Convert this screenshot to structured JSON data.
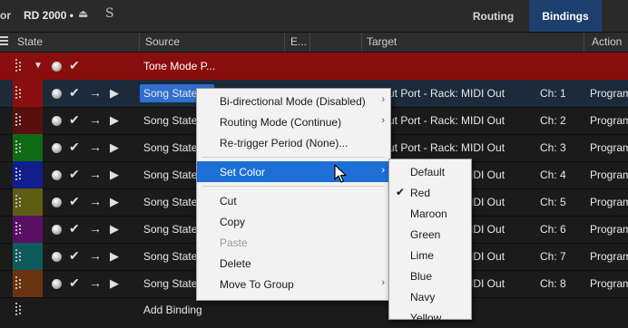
{
  "topbar": {
    "edge_text": "or",
    "device_name": "RD 2000 •",
    "eject_glyph": "⏏",
    "logo_glyph": "S",
    "tabs": [
      {
        "label": "Routing",
        "active": false
      },
      {
        "label": "Bindings",
        "active": true
      }
    ]
  },
  "columns": {
    "state": "State",
    "source": "Source",
    "e": "E...",
    "target": "Target",
    "action": "Action"
  },
  "group_row": {
    "title": "Tone Mode P...",
    "color": "#8a0e0e"
  },
  "rows": [
    {
      "source": "Song State",
      "target": "ut Port - Rack: MIDI Out",
      "channel": "Ch: 1",
      "action": "Program",
      "color": "#8b0f0f",
      "selected": true
    },
    {
      "source": "Song State",
      "target": "ut Port - Rack: MIDI Out",
      "channel": "Ch: 2",
      "action": "Program",
      "color": "#5a0f0f"
    },
    {
      "source": "Song State",
      "target": "ut Port - Rack: MIDI Out",
      "channel": "Ch: 3",
      "action": "Program",
      "color": "#0e6a14"
    },
    {
      "source": "Song State",
      "target": "ut Port - Rack: MIDI Out",
      "channel": "Ch: 4",
      "action": "Program",
      "color": "#121d8c"
    },
    {
      "source": "Song State",
      "target": "ut Port - Rack: MIDI Out",
      "channel": "Ch: 5",
      "action": "Program",
      "color": "#5d5d12"
    },
    {
      "source": "Song State",
      "target": "ut Port - Rack: MIDI Out",
      "channel": "Ch: 6",
      "action": "Program",
      "color": "#5a0f62"
    },
    {
      "source": "Song State",
      "target": "ut Port - Rack: MIDI Out",
      "channel": "Ch: 7",
      "action": "Program",
      "color": "#0f5a5a"
    },
    {
      "source": "Song State",
      "target": "ut Port - Rack: MIDI Out",
      "channel": "Ch: 8",
      "action": "Program",
      "color": "#6a3410"
    }
  ],
  "add_binding_label": "Add Binding",
  "context_menu": {
    "items": [
      {
        "label": "Bi-directional Mode (Disabled)",
        "submenu": true
      },
      {
        "label": "Routing Mode (Continue)",
        "submenu": true
      },
      {
        "label": "Re-trigger Period (None)...",
        "submenu": false
      },
      {
        "label": "Set Color",
        "submenu": true,
        "active": true
      },
      {
        "label": "Cut",
        "submenu": false
      },
      {
        "label": "Copy",
        "submenu": false
      },
      {
        "label": "Paste",
        "submenu": false,
        "disabled": true
      },
      {
        "label": "Delete",
        "submenu": false
      },
      {
        "label": "Move To Group",
        "submenu": true
      }
    ],
    "submenu_arrow": "›"
  },
  "color_submenu": {
    "items": [
      "Default",
      "Red",
      "Maroon",
      "Green",
      "Lime",
      "Blue",
      "Navy",
      "Yellow"
    ],
    "checked": "Red",
    "check_glyph": "✔"
  },
  "icons": {
    "check": "✔",
    "arrow": "→",
    "play": "▶",
    "caret": "▼"
  },
  "accent_color": "#1d6fd6"
}
